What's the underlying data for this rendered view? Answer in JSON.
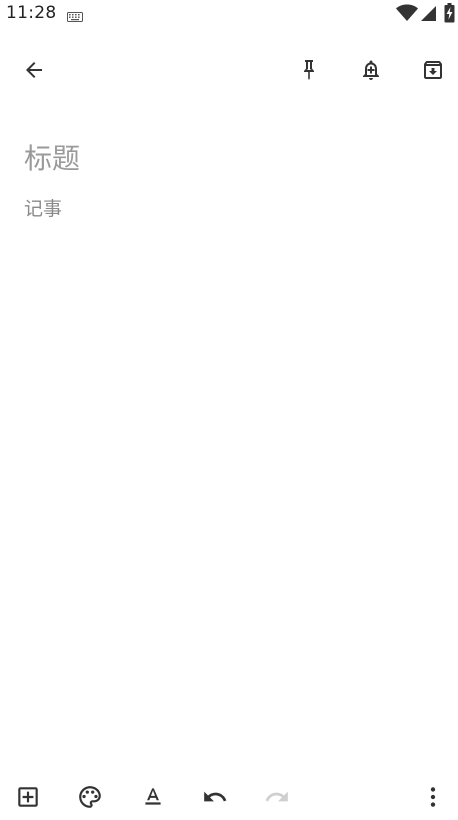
{
  "status_bar": {
    "time": "11:28"
  },
  "top_bar": {
    "back_icon": "arrow-back-icon",
    "pin_icon": "pin-icon",
    "reminder_icon": "reminder-bell-icon",
    "archive_icon": "archive-icon"
  },
  "editor": {
    "title_placeholder": "标题",
    "title_value": "",
    "note_placeholder": "记事",
    "note_value": ""
  },
  "bottom_bar": {
    "add_icon": "add-box-icon",
    "palette_icon": "palette-icon",
    "format_icon": "text-format-icon",
    "undo_icon": "undo-icon",
    "redo_icon": "redo-icon",
    "more_icon": "more-vert-icon"
  },
  "colors": {
    "icon": "#333333",
    "icon_disabled": "#cfcfcf",
    "placeholder_title": "#9a9a9a",
    "placeholder_note": "#8a8a8a",
    "background": "#ffffff"
  }
}
